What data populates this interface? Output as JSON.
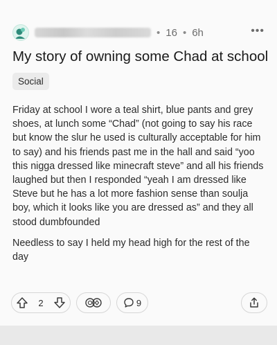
{
  "post": {
    "meta": {
      "votes_small": "16",
      "age": "6h",
      "separator": "•",
      "more_label": "•••"
    },
    "title": "My story of owning some Chad at school",
    "flair": "Social",
    "body": [
      "Friday at school I wore a teal shirt, blue pants and grey shoes, at lunch some “Chad” (not going to say his race but know the slur he used is culturally acceptable for him to say) and his friends past me in the hall and said “yoo this nigga dressed like minecraft steve” and all his friends laughed but then I responded “yeah I am dressed like Steve but he has a lot more fashion sense than soulja boy, which it looks like you are dressed as” and they all stood dumbfounded",
      "Needless to say I held my head high for the rest of the day"
    ],
    "actions": {
      "upvote_count": "2",
      "comment_count": "9"
    }
  },
  "icons": {
    "avatar": "avatar-icon",
    "upvote": "arrow-up-icon",
    "downvote": "arrow-down-icon",
    "award": "award-icon",
    "comment": "comment-icon",
    "share": "share-icon"
  },
  "colors": {
    "card_background": "#fafafa",
    "page_background": "#eaeaea",
    "text": "#1c1c1c",
    "meta_text": "#6b6b6b",
    "flair_background": "#ebebeb",
    "avatar_accent": "#2e8b7a"
  }
}
